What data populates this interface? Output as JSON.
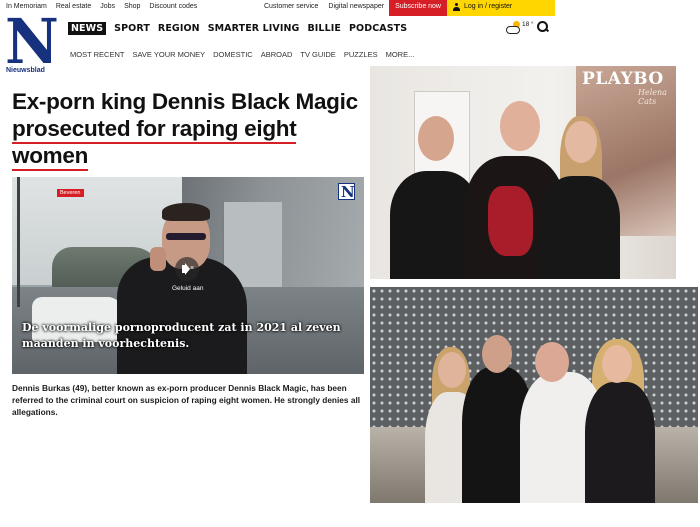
{
  "utility": {
    "left_links": [
      "In Memoriam",
      "Real estate",
      "Jobs",
      "Shop",
      "Discount codes"
    ],
    "customer_service": "Customer service",
    "digital_newspaper": "Digital newspaper",
    "subscribe": "Subscribe now",
    "login": "Log in / register"
  },
  "brand": {
    "logo_letter": "N",
    "logo_name": "Nieuwsblad",
    "color": "#16317d"
  },
  "main_nav": {
    "active": "NEWS",
    "items": [
      "SPORT",
      "REGION",
      "SMARTER LIVING",
      "BILLIE",
      "PODCASTS"
    ]
  },
  "weather": {
    "temperature": "18 °",
    "icon": "partly-cloudy-icon"
  },
  "sub_nav": [
    "MOST RECENT",
    "SAVE YOUR MONEY",
    "DOMESTIC",
    "ABROAD",
    "TV GUIDE",
    "PUZZLES",
    "MORE..."
  ],
  "article": {
    "headline_lines": [
      "Ex-porn king Dennis Black Magic",
      "prosecuted for raping eight",
      "women"
    ],
    "video": {
      "location": "Beveren",
      "mute_label": "Geluid aan",
      "caption": "De voormalige pornoproducent zat in 2021 al zeven maanden in voorhechtenis."
    },
    "lede": "Dennis Burkas (49), better known as ex-porn producer Dennis Black Magic, has been referred to the criminal court on suspicion of raping eight women. He strongly denies all allegations."
  },
  "photos": {
    "top": {
      "poster_title": "PLAYBO",
      "poster_subtitle": "Helena Cats"
    }
  },
  "colors": {
    "accent_red": "#d51e26",
    "login_yellow": "#ffd600"
  }
}
